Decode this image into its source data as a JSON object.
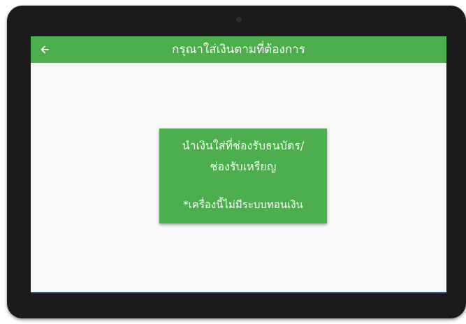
{
  "app_bar": {
    "back_icon": "arrow-left-icon",
    "title": "กรุณาใส่เงินตามที่ต้องการ"
  },
  "notice": {
    "line1": "นำเงินใส่ที่ช่องรับธนบัตร/",
    "line2": "ช่องรับเหรียญ",
    "warning": "*เครื่องนี้ไม่มีระบบทอนเงิน"
  },
  "colors": {
    "brand_green": "#4cae4c",
    "frame": "#1a1a1a",
    "screen_background": "#f8f8f8"
  }
}
